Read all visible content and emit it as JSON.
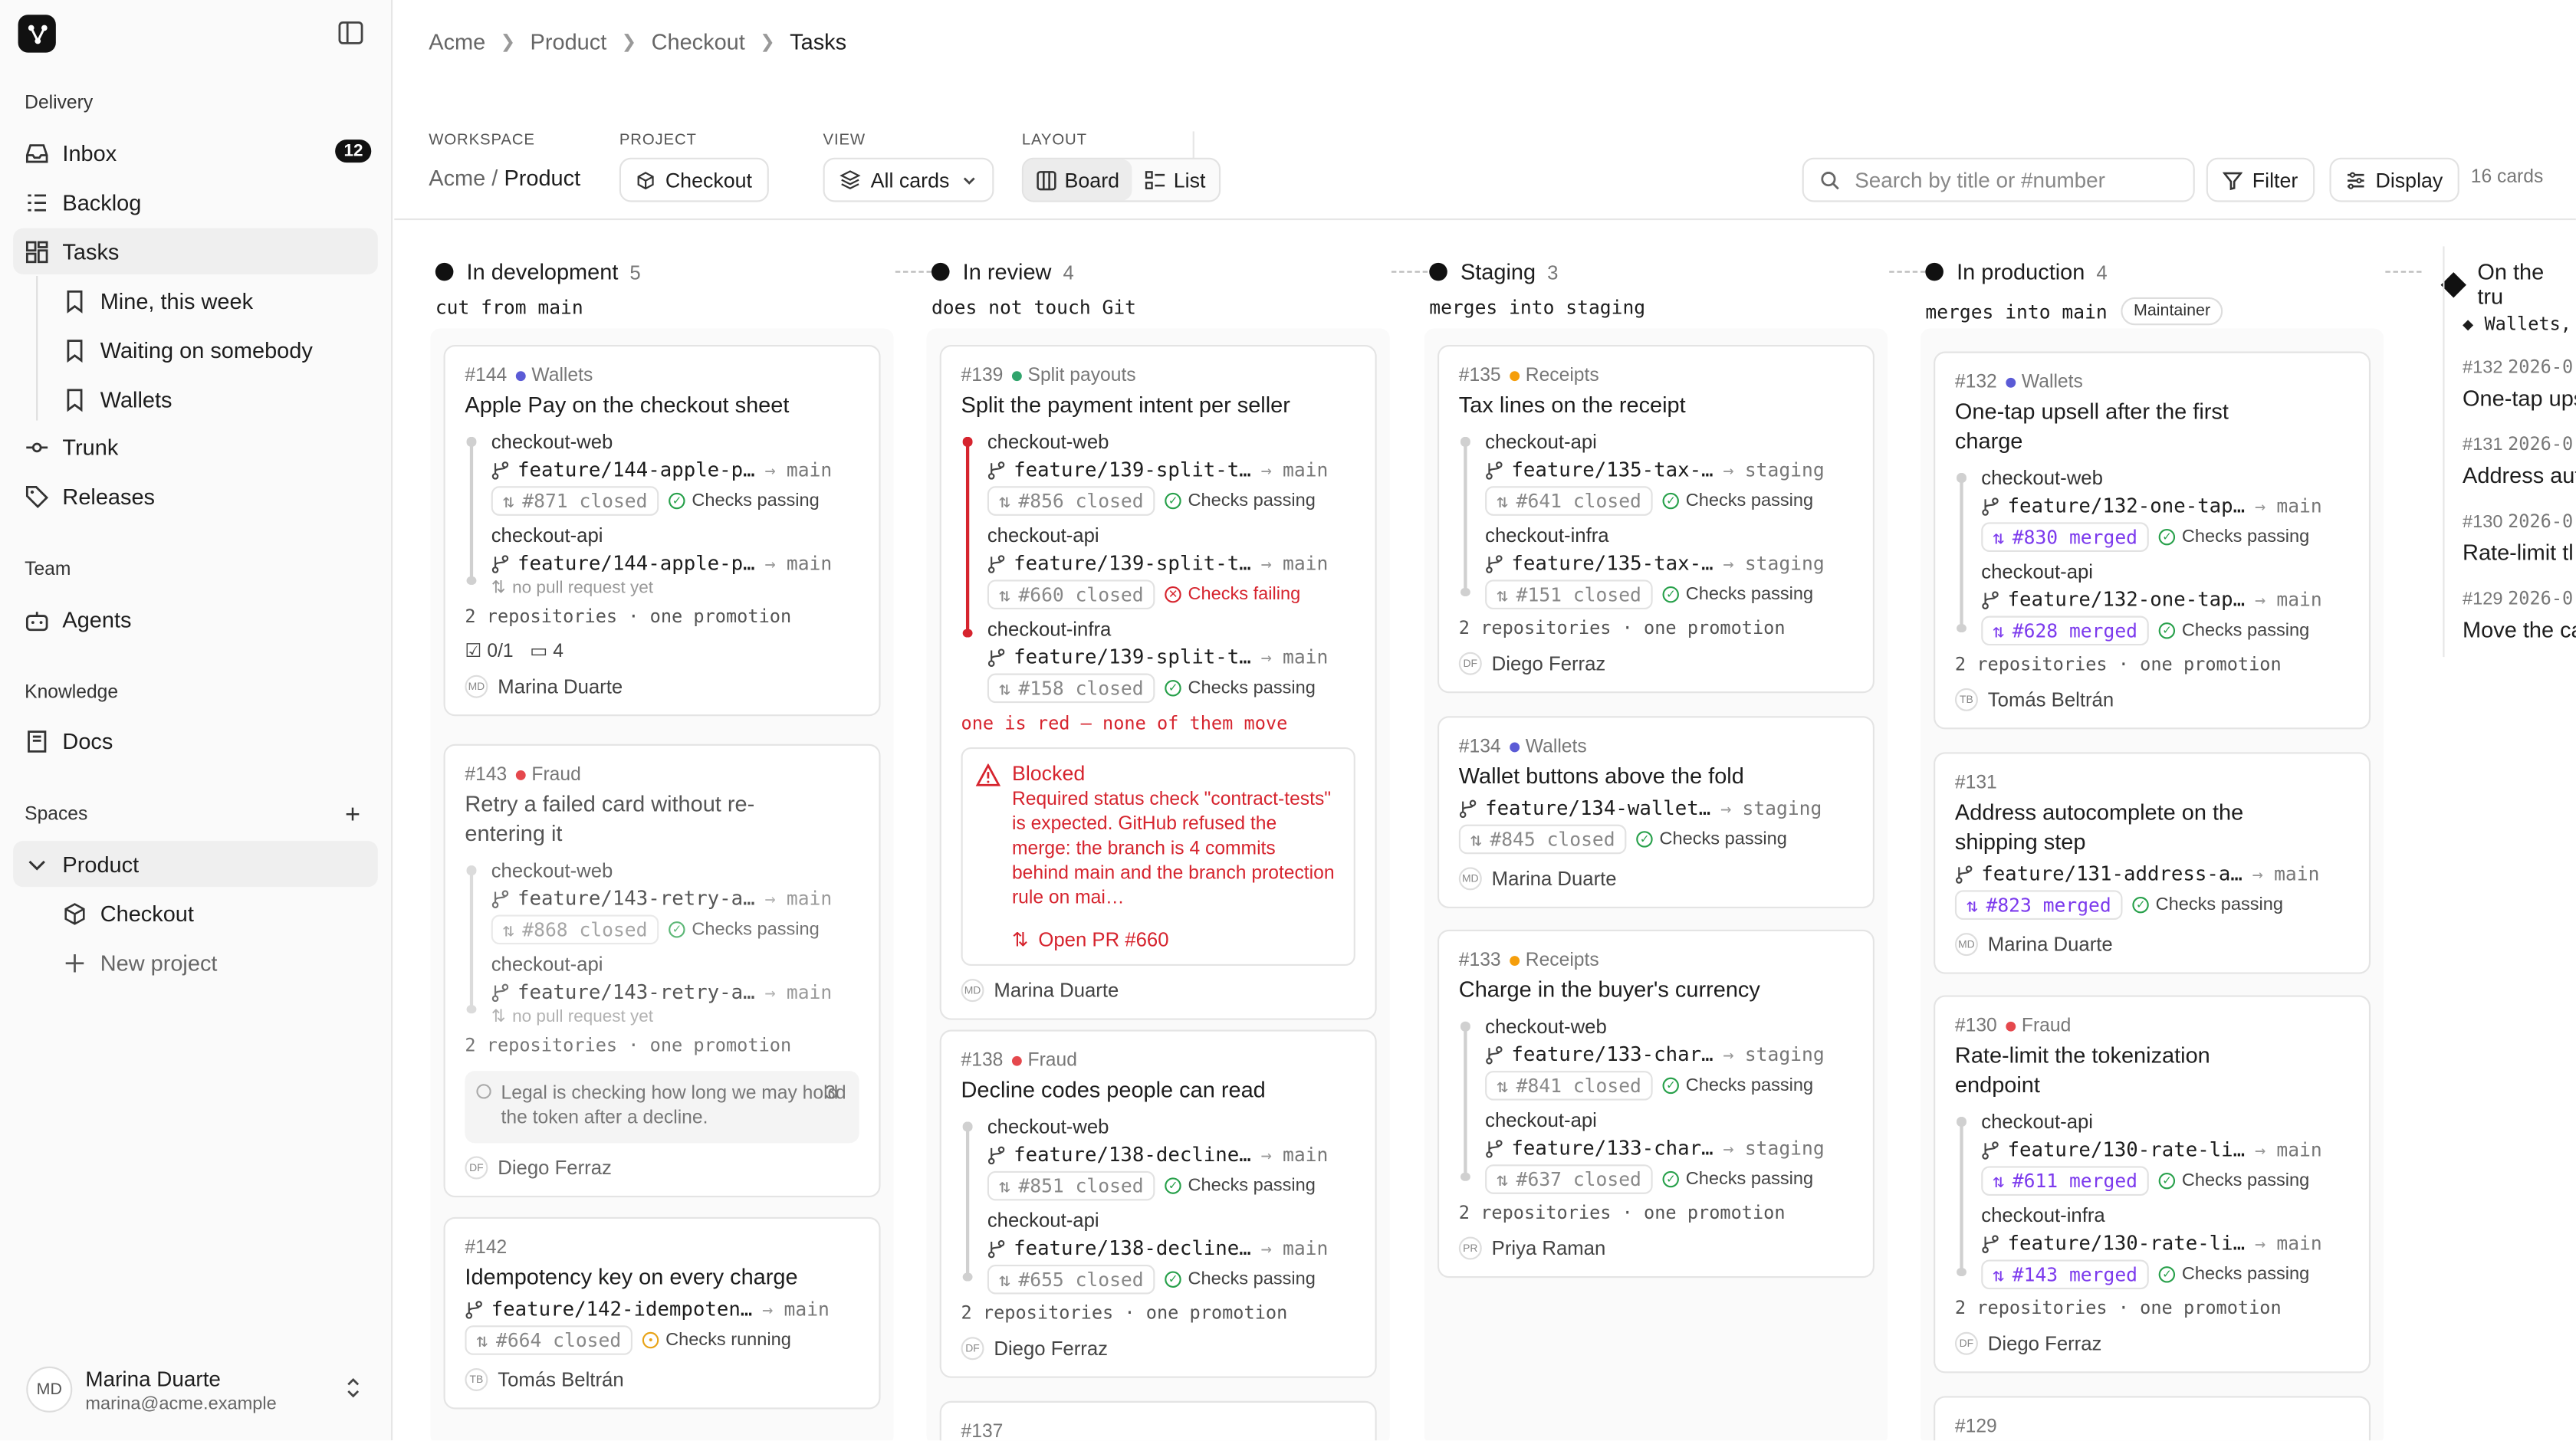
{
  "sidebar": {
    "section_delivery": "Delivery",
    "inbox": "Inbox",
    "inbox_count": "12",
    "backlog": "Backlog",
    "tasks": "Tasks",
    "mine": "Mine, this week",
    "waiting": "Waiting on somebody",
    "wallets": "Wallets",
    "trunk": "Trunk",
    "releases": "Releases",
    "section_team": "Team",
    "agents": "Agents",
    "section_knowledge": "Knowledge",
    "docs": "Docs",
    "section_spaces": "Spaces",
    "product": "Product",
    "checkout": "Checkout",
    "new_project": "New project",
    "user_name": "Marina Duarte",
    "user_email": "marina@acme.example",
    "user_initials": "MD"
  },
  "breadcrumb": [
    "Acme",
    "Product",
    "Checkout",
    "Tasks"
  ],
  "toolbar": {
    "workspace_label": "WORKSPACE",
    "workspace_org": "Acme",
    "workspace_sep": "/",
    "workspace_space": "Product",
    "project_label": "PROJECT",
    "project_value": "Checkout",
    "view_label": "VIEW",
    "view_value": "All cards",
    "layout_label": "LAYOUT",
    "layout_board": "Board",
    "layout_list": "List",
    "search_placeholder": "Search by title or #number",
    "filter": "Filter",
    "display": "Display",
    "card_count": "16 cards"
  },
  "columns": [
    {
      "name": "In development",
      "count": "5",
      "sub": "cut from main"
    },
    {
      "name": "In review",
      "count": "4",
      "sub": "does not touch Git"
    },
    {
      "name": "Staging",
      "count": "3",
      "sub": "merges into staging"
    },
    {
      "name": "In production",
      "count": "4",
      "sub": "merges into main",
      "badge": "Maintainer"
    },
    {
      "name": "On the tru",
      "count": "",
      "sub": "Wallets,"
    }
  ],
  "cards": {
    "c144": {
      "id": "#144",
      "tag": "Wallets",
      "title": "Apple Pay on the checkout sheet",
      "r1": "checkout-web",
      "b1": "feature/144-apple-p…",
      "t1": "main",
      "pr1": "#871 closed",
      "ck1": "Checks passing",
      "r2": "checkout-api",
      "b2": "feature/144-apple-p…",
      "t2": "main",
      "nopr": "no pull request yet",
      "meta": "2 repositories · one promotion",
      "todo": "0/1",
      "comments": "4",
      "owner": "Marina Duarte",
      "ini": "MD"
    },
    "c143": {
      "id": "#143",
      "tag": "Fraud",
      "title": "Retry a failed card without re-entering it",
      "r1": "checkout-web",
      "b1": "feature/143-retry-a…",
      "t1": "main",
      "pr1": "#868 closed",
      "ck1": "Checks passing",
      "r2": "checkout-api",
      "b2": "feature/143-retry-a…",
      "t2": "main",
      "nopr": "no pull request yet",
      "meta": "2 repositories · one promotion",
      "note": "Legal is checking how long we may hold the token after a decline.",
      "note_age": "3d",
      "owner": "Diego Ferraz",
      "ini": "DF"
    },
    "c142": {
      "id": "#142",
      "title": "Idempotency key on every charge",
      "b1": "feature/142-idempoten…",
      "t1": "main",
      "pr1": "#664 closed",
      "ck1": "Checks running",
      "owner": "Tomás Beltrán",
      "ini": "TB"
    },
    "c139": {
      "id": "#139",
      "tag": "Split payouts",
      "title": "Split the payment intent per seller",
      "r1": "checkout-web",
      "b1": "feature/139-split-t…",
      "t1": "main",
      "pr1": "#856 closed",
      "ck1": "Checks passing",
      "r2": "checkout-api",
      "b2": "feature/139-split-t…",
      "t2": "main",
      "pr2": "#660 closed",
      "ck2": "Checks failing",
      "r3": "checkout-infra",
      "b3": "feature/139-split-t…",
      "t3": "main",
      "pr3": "#158 closed",
      "ck3": "Checks passing",
      "warn": "one is red — none of them move",
      "blocked_title": "Blocked",
      "blocked_body": "Required status check \"contract-tests\" is expected. GitHub refused the merge: the branch is 4 commits behind main and the branch protection rule on mai…",
      "open_pr": "Open PR #660",
      "owner": "Marina Duarte",
      "ini": "MD"
    },
    "c138": {
      "id": "#138",
      "tag": "Fraud",
      "title": "Decline codes people can read",
      "r1": "checkout-web",
      "b1": "feature/138-decline…",
      "t1": "main",
      "pr1": "#851 closed",
      "ck1": "Checks passing",
      "r2": "checkout-api",
      "b2": "feature/138-decline…",
      "t2": "main",
      "pr2": "#655 closed",
      "ck2": "Checks passing",
      "meta": "2 repositories · one promotion",
      "owner": "Diego Ferraz",
      "ini": "DF"
    },
    "c137": {
      "id": "#137"
    },
    "c135": {
      "id": "#135",
      "tag": "Receipts",
      "title": "Tax lines on the receipt",
      "r1": "checkout-api",
      "b1": "feature/135-tax-…",
      "t1": "staging",
      "pr1": "#641 closed",
      "ck1": "Checks passing",
      "r2": "checkout-infra",
      "b2": "feature/135-tax-…",
      "t2": "staging",
      "pr2": "#151 closed",
      "ck2": "Checks passing",
      "meta": "2 repositories · one promotion",
      "owner": "Diego Ferraz",
      "ini": "DF"
    },
    "c134": {
      "id": "#134",
      "tag": "Wallets",
      "title": "Wallet buttons above the fold",
      "b1": "feature/134-wallet…",
      "t1": "staging",
      "pr1": "#845 closed",
      "ck1": "Checks passing",
      "owner": "Marina Duarte",
      "ini": "MD"
    },
    "c133": {
      "id": "#133",
      "tag": "Receipts",
      "title": "Charge in the buyer's currency",
      "r1": "checkout-web",
      "b1": "feature/133-char…",
      "t1": "staging",
      "pr1": "#841 closed",
      "ck1": "Checks passing",
      "r2": "checkout-api",
      "b2": "feature/133-char…",
      "t2": "staging",
      "pr2": "#637 closed",
      "ck2": "Checks passing",
      "meta": "2 repositories · one promotion",
      "owner": "Priya Raman",
      "ini": "PR"
    },
    "c132": {
      "id": "#132",
      "tag": "Wallets",
      "title": "One-tap upsell after the first charge",
      "r1": "checkout-web",
      "b1": "feature/132-one-tap…",
      "t1": "main",
      "pr1": "#830 merged",
      "ck1": "Checks passing",
      "r2": "checkout-api",
      "b2": "feature/132-one-tap…",
      "t2": "main",
      "pr2": "#628 merged",
      "ck2": "Checks passing",
      "meta": "2 repositories · one promotion",
      "owner": "Tomás Beltrán",
      "ini": "TB"
    },
    "c131": {
      "id": "#131",
      "title": "Address autocomplete on the shipping step",
      "b1": "feature/131-address-a…",
      "t1": "main",
      "pr1": "#823 merged",
      "ck1": "Checks passing",
      "owner": "Marina Duarte",
      "ini": "MD"
    },
    "c130": {
      "id": "#130",
      "tag": "Fraud",
      "title": "Rate-limit the tokenization endpoint",
      "r1": "checkout-api",
      "b1": "feature/130-rate-li…",
      "t1": "main",
      "pr1": "#611 merged",
      "ck1": "Checks passing",
      "r2": "checkout-infra",
      "b2": "feature/130-rate-li…",
      "t2": "main",
      "pr2": "#143 merged",
      "ck2": "Checks passing",
      "meta": "2 repositories · one promotion",
      "owner": "Diego Ferraz",
      "ini": "DF"
    },
    "c129": {
      "id": "#129"
    }
  },
  "trunk": [
    {
      "id": "#132",
      "date": "2026-0",
      "title": "One-tap ups"
    },
    {
      "id": "#131",
      "date": "2026-0",
      "title": "Address aut"
    },
    {
      "id": "#130",
      "date": "2026-0",
      "title": "Rate-limit tl"
    },
    {
      "id": "#129",
      "date": "2026-0",
      "title": "Move the ca"
    }
  ],
  "colors": {
    "wallets": "#5b5bd6",
    "fraud": "#e5484d",
    "receipts": "#f59e0b",
    "split": "#30a46c",
    "fail": "#d6242e",
    "merged": "#7c3aed"
  }
}
